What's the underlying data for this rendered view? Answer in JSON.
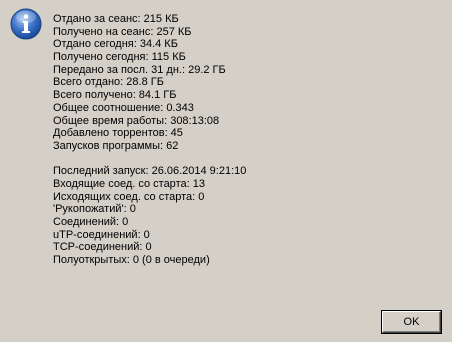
{
  "dialog": {
    "icon": "info-icon",
    "lines": [
      "Отдано за сеанс: 215 КБ",
      "Получено на сеанс: 257 КБ",
      "Отдано сегодня: 34.4 КБ",
      "Получено сегодня: 115 КБ",
      "Передано за посл. 31 дн.: 29.2 ГБ",
      "Всего отдано: 28.8 ГБ",
      "Всего получено: 84.1 ГБ",
      "Общее соотношение: 0.343",
      "Общее время работы: 308:13:08",
      "Добавлено торрентов: 45",
      "Запусков программы: 62"
    ],
    "lines2": [
      "Последний запуск: 26.06.2014 9:21:10",
      "Входящие соед. со старта: 13",
      "Исходящих соед. со старта: 0",
      "'Рукопожатий': 0",
      "Соединений: 0",
      "uTP-соединений: 0",
      "TCP-соединений: 0",
      "Полуоткрытых: 0 (0 в очереди)"
    ],
    "ok_label": "OK"
  }
}
